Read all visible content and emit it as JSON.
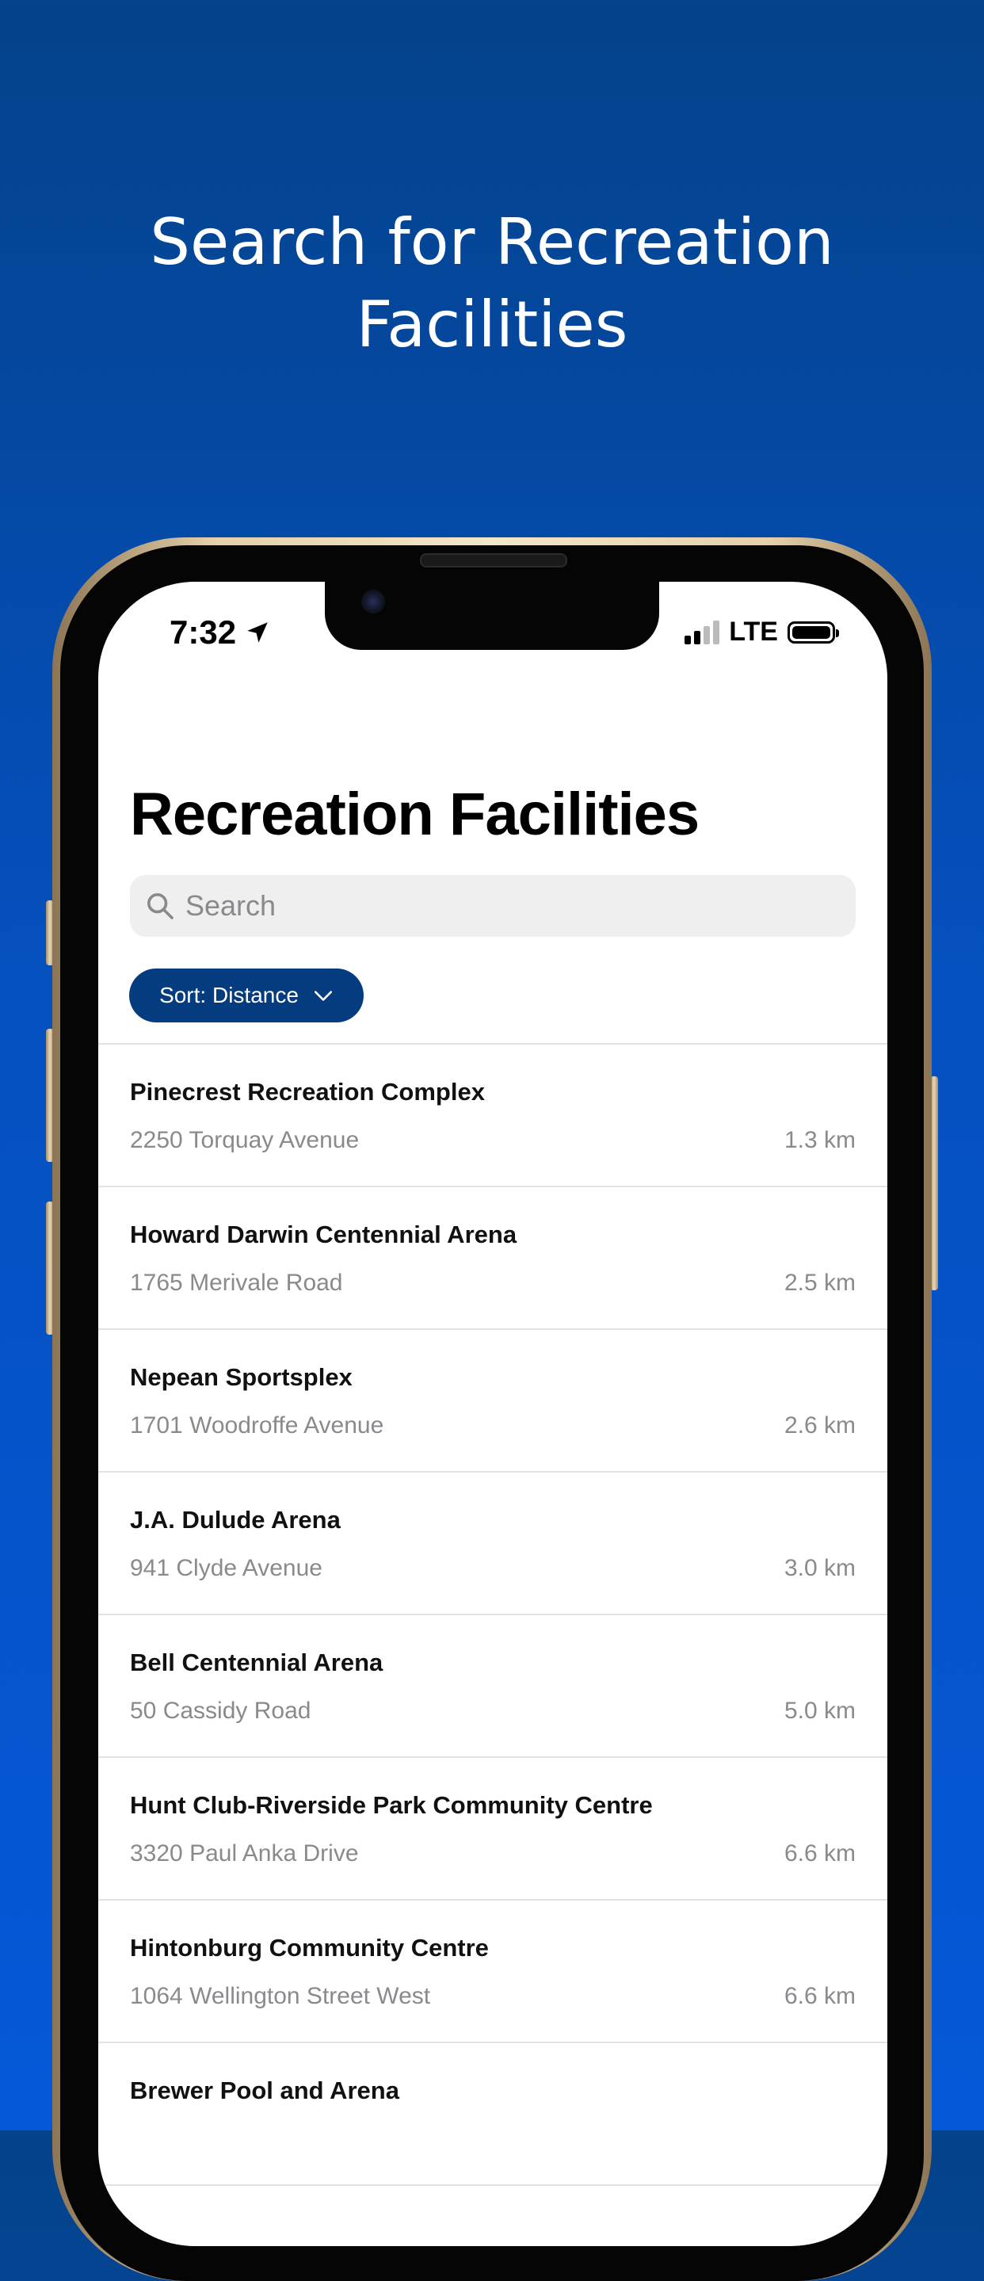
{
  "marketing": {
    "headline_line1": "Search for Recreation",
    "headline_line2": "Facilities"
  },
  "status_bar": {
    "time": "7:32",
    "network": "LTE"
  },
  "screen": {
    "title": "Recreation Facilities",
    "search": {
      "placeholder": "Search",
      "value": ""
    },
    "sort_label": "Sort: Distance",
    "facilities": [
      {
        "name": "Pinecrest Recreation Complex",
        "address": "2250 Torquay Avenue",
        "distance": "1.3 km"
      },
      {
        "name": "Howard Darwin Centennial Arena",
        "address": "1765 Merivale Road",
        "distance": "2.5 km"
      },
      {
        "name": "Nepean Sportsplex",
        "address": "1701 Woodroffe Avenue",
        "distance": "2.6 km"
      },
      {
        "name": "J.A. Dulude Arena",
        "address": "941 Clyde Avenue",
        "distance": "3.0 km"
      },
      {
        "name": "Bell Centennial Arena",
        "address": "50 Cassidy Road",
        "distance": "5.0 km"
      },
      {
        "name": "Hunt Club-Riverside Park Community Centre",
        "address": "3320 Paul Anka Drive",
        "distance": "6.6 km"
      },
      {
        "name": "Hintonburg Community Centre",
        "address": "1064 Wellington Street West",
        "distance": "6.6 km"
      },
      {
        "name": "Brewer Pool and Arena",
        "address": "",
        "distance": ""
      }
    ]
  },
  "icons": {
    "location_arrow": "location-arrow-icon",
    "signal": "signal-icon",
    "battery": "battery-icon",
    "search": "search-icon",
    "chevron": "chevron-down-icon"
  },
  "colors": {
    "background_top": "#04428a",
    "background_bottom": "#0558d8",
    "sort_button": "#053c7f",
    "secondary_text": "#8a8a8e"
  }
}
